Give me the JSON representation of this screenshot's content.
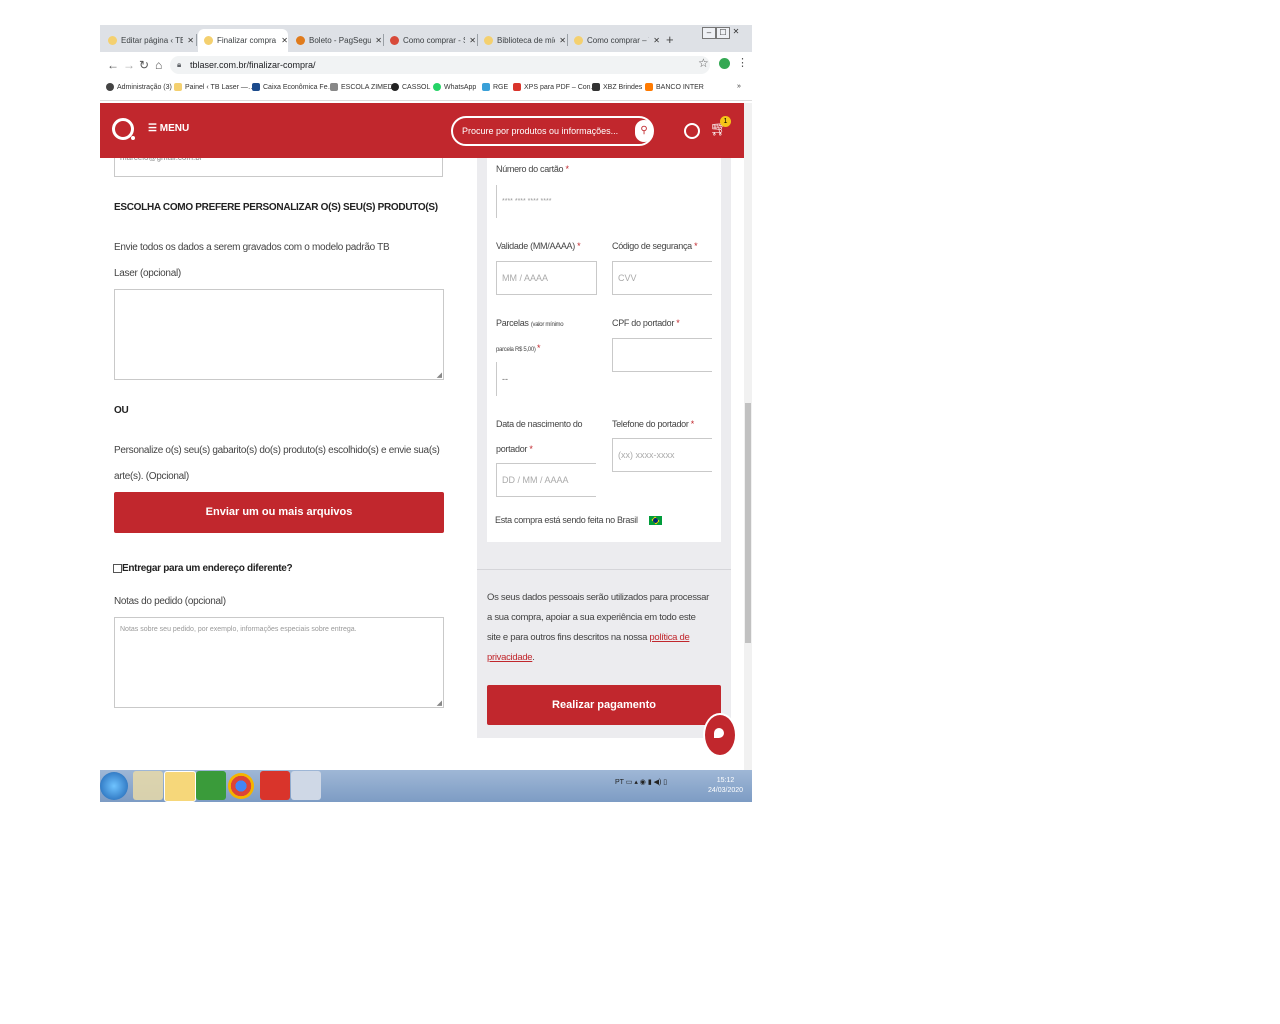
{
  "browser": {
    "tabs": [
      {
        "title": "Editar página ‹ TB Laser",
        "active": false
      },
      {
        "title": "Finalizar compra – TB Laser",
        "active": true
      },
      {
        "title": "Boleto - PagSeguro UOL",
        "active": false
      },
      {
        "title": "Como comprar - Sou Lojista",
        "active": false
      },
      {
        "title": "Biblioteca de mídia ‹ TB Laser",
        "active": false
      },
      {
        "title": "Como comprar – TB Laser",
        "active": false
      }
    ],
    "url": "tblaser.com.br/finalizar-compra/",
    "bookmarks": [
      "Administração (3)",
      "Painel ‹ TB Laser —…",
      "Caixa Econômica Fe…",
      "ESCOLA ZIMEDI",
      "CASSOL",
      "WhatsApp",
      "RGE",
      "XPS para PDF – Con…",
      "XBZ Brindes",
      "BANCO INTER"
    ],
    "window_controls": [
      "–",
      "☐",
      "✕"
    ]
  },
  "site": {
    "menu_label": "MENU",
    "search_placeholder": "Procure por produtos ou informações...",
    "cart_count": "1"
  },
  "left": {
    "email_partial": "marcelo@gmail.com.br",
    "personalize_heading": "ESCOLHA COMO PREFERE PERSONALIZAR O(S) SEU(S) PRODUTO(S)",
    "send_data_label_1": "Envie todos os dados a serem gravados com o modelo padrão TB",
    "send_data_label_2": "Laser (opcional)",
    "or_label": "OU",
    "personalize_text_1": "Personalize o(s) seu(s) gabarito(s) do(s) produto(s) escolhido(s) e envie sua(s)",
    "personalize_text_2": "arte(s). (Opcional)",
    "upload_button": "Enviar um ou mais arquivos",
    "different_address_label": "Entregar para um endereço diferente?",
    "order_notes_label": "Notas do pedido (opcional)",
    "order_notes_placeholder": "Notas sobre seu pedido, por exemplo, informações especiais sobre entrega."
  },
  "payment": {
    "card_number_label": "Número do cartão",
    "card_number_placeholder": "**** **** **** ****",
    "expiry_label": "Validade (MM/AAAA)",
    "expiry_placeholder": "MM / AAAA",
    "cvv_label": "Código de segurança",
    "cvv_placeholder": "CVV",
    "installments_label": "Parcelas",
    "installments_note": "(valor mínimo",
    "installments_note_2": "parcela R$ 5,00)",
    "installments_value": "--",
    "cpf_label": "CPF do portador",
    "birth_label_1": "Data de nascimento do",
    "birth_label_2": "portador",
    "birth_placeholder": "DD / MM / AAAA",
    "phone_label": "Telefone do portador",
    "phone_placeholder": "(xx) xxxx-xxxx",
    "country_note": "Esta compra está sendo feita no Brasil",
    "required_mark": "*"
  },
  "privacy": {
    "text_1": "Os seus dados pessoais serão utilizados para processar",
    "text_2": "a sua compra, apoiar a sua experiência em todo este",
    "text_3": "site e para outros fins descritos na nossa",
    "link_1": "política de",
    "link_2": "privacidade",
    "suffix": "."
  },
  "pay_button": "Realizar pagamento",
  "taskbar": {
    "language": "PT",
    "time": "15:12",
    "date": "24/03/2020"
  },
  "colors": {
    "brand": "#c1272d",
    "badge": "#f5c518"
  }
}
